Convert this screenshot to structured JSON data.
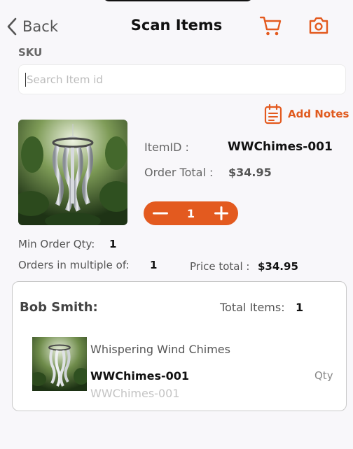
{
  "header": {
    "back_label": "Back",
    "title": "Scan Items",
    "cart_icon": "cart-icon",
    "camera_icon": "camera-icon"
  },
  "search": {
    "label": "SKU",
    "placeholder": "Search Item id",
    "value": ""
  },
  "notes": {
    "label": "Add Notes",
    "icon": "notes-icon"
  },
  "item": {
    "id_label": "ItemID :",
    "id_value": "WWChimes-001",
    "order_total_label": "Order Total :",
    "order_total_value": "$34.95",
    "quantity": "1",
    "min_order_label": "Min Order Qty:",
    "min_order_value": "1",
    "multiple_label": "Orders in multiple of:",
    "multiple_value": "1",
    "price_total_label": "Price total :",
    "price_total_value": "$34.95"
  },
  "summary": {
    "customer": "Bob Smith:",
    "total_items_label": "Total Items:",
    "total_items_value": "1",
    "lines": [
      {
        "name": "Whispering Wind Chimes",
        "sku": "WWChimes-001",
        "sku_sub": "WWChimes-001",
        "qty_label": "Qty"
      }
    ]
  },
  "colors": {
    "accent": "#e35a1f",
    "background": "#f8f7fa"
  }
}
